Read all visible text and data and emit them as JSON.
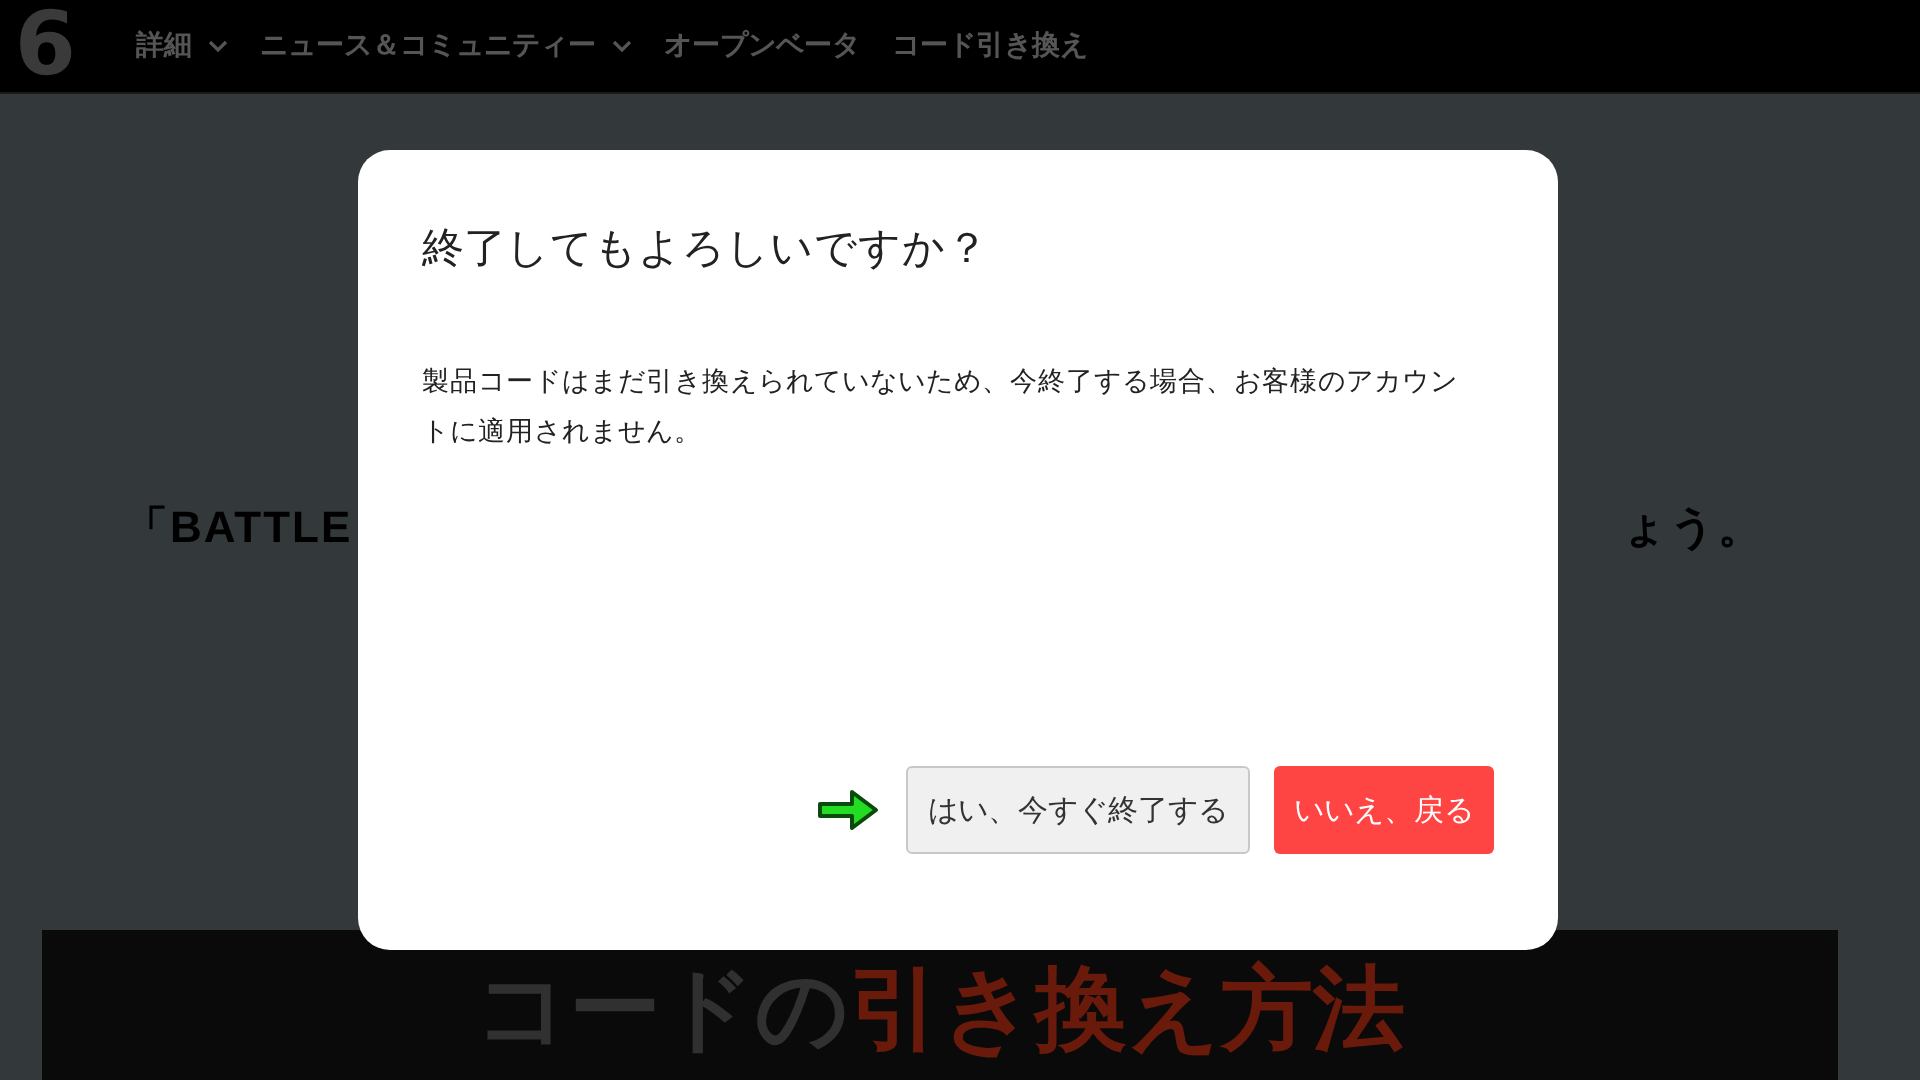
{
  "nav": {
    "logo": "6",
    "items": [
      {
        "label": "詳細",
        "dropdown": true
      },
      {
        "label": "ニュース＆コミュニティー",
        "dropdown": true
      },
      {
        "label": "オープンベータ",
        "dropdown": false
      },
      {
        "label": "コード引き換え",
        "dropdown": false
      }
    ]
  },
  "background": {
    "heading_start": "「BATTLE",
    "heading_end": "ょう。",
    "banner_title_gray": "コードの",
    "banner_title_red": "引き換え方法"
  },
  "dialog": {
    "title": "終了してもよろしいですか？",
    "message": "製品コードはまだ引き換えられていないため、今終了する場合、お客様のアカウントに適用されません。",
    "buttons": [
      {
        "label": "はい、今すぐ終了する",
        "kind": "secondary"
      },
      {
        "label": "いいえ、戻る",
        "kind": "primary"
      }
    ]
  }
}
